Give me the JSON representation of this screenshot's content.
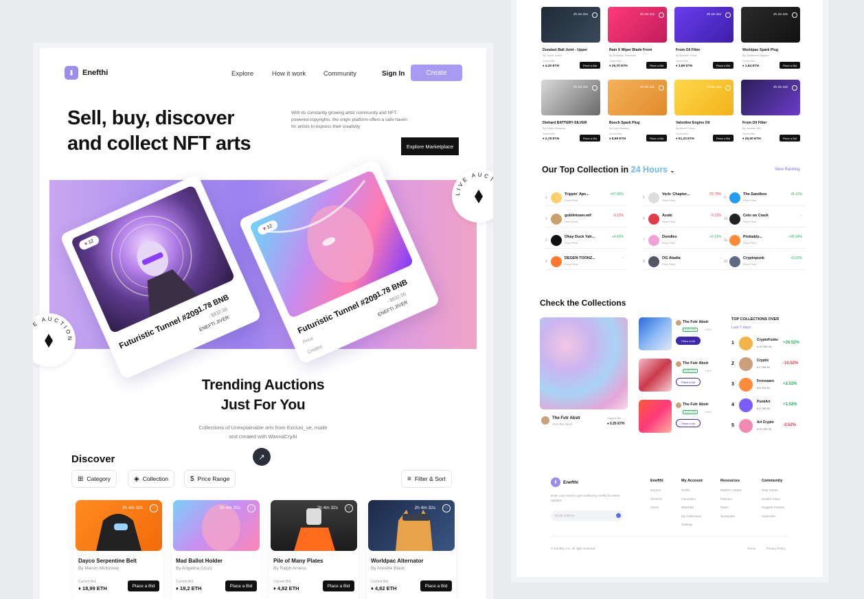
{
  "nav": {
    "brand": "Enefthi",
    "links": [
      "Explore",
      "How it work",
      "Community"
    ],
    "sign_in": "Sign In",
    "create": "Create"
  },
  "hero": {
    "title_line1": "Sell, buy, discover",
    "title_line2": "and collect NFT arts",
    "description": "With its constantly growing artist community and NFT-powered copyrights, the origin platform offers a safe haven for artists to express their creativity",
    "cta": "Explore Marketplace",
    "live_badge": "LIVE AUCTION"
  },
  "hero_cards": [
    {
      "title": "Futuristic Tunnel #209",
      "price": "1.78 BNB",
      "usd": "- $832.56",
      "creator": "ENEFTI JIVER",
      "likes": "12"
    },
    {
      "title": "Futuristic Tunnel #209",
      "price": "1.78 BNB",
      "usd": "- $832.56",
      "creator": "ENEFTI JIVER",
      "likes": "12",
      "price_label": "Price",
      "creator_label": "Creator"
    }
  ],
  "trending": {
    "title_line1": "Trending Auctions",
    "title_line2": "Just For You",
    "sub_line1": "Collections of Unexplainable arts from Exclusi_ve, made",
    "sub_line2": "and created with WannaCryAI"
  },
  "discover": {
    "title": "Discover",
    "filters": [
      "Category",
      "Collection",
      "Price Range"
    ],
    "filter_sort": "Filter & Sort",
    "items": [
      {
        "name": "Dayco Serpentine Belt",
        "by": "By Marvin McKinney",
        "timer": "2h 4m 32s",
        "bid_label": "Current Bid",
        "eth": "18,99 ETH",
        "button": "Place a Bid"
      },
      {
        "name": "Mad Ballot Holder",
        "by": "By Angelina Cruzz",
        "timer": "2h 4m 32s",
        "bid_label": "Current Bid",
        "eth": "18,2 ETH",
        "button": "Place a Bid"
      },
      {
        "name": "Pile of Many Plates",
        "by": "By Ralph Arness",
        "timer": "2h 4m 32s",
        "bid_label": "Current Bid",
        "eth": "4,82 ETH",
        "button": "Place a Bid"
      },
      {
        "name": "Worldpac Alternator",
        "by": "By Annette Black",
        "timer": "2h 4m 32s",
        "bid_label": "Current Bid",
        "eth": "4,82 ETH",
        "button": "Place a Bid"
      }
    ]
  },
  "right_grid": [
    {
      "name": "Duralast Ball Joint - Upper",
      "by": "By Jacob Jones",
      "eth": "4,30 ETH",
      "timer": "2h 4m 32s"
    },
    {
      "name": "Rain X Wiper Blade Front",
      "by": "By Brooklyn Simmons",
      "eth": "25,70 ETH",
      "timer": "2h 4m 32s"
    },
    {
      "name": "From Oil Filter",
      "by": "By Eleanor Pena",
      "eth": "3,89 ETH",
      "timer": "2h 4m 32s"
    },
    {
      "name": "Worldpac Spark Plug",
      "by": "By Savannah Nguyen",
      "eth": "1,94 ETH",
      "timer": "2h 4m 32s"
    },
    {
      "name": "Diehard BATTERY-SILVER",
      "by": "By Ralph Edwards",
      "eth": "2,78 ETH",
      "timer": "2h 4m 32s"
    },
    {
      "name": "Bosch Spark Plug",
      "by": "By Guy Hawkins",
      "eth": "8,99 ETH",
      "timer": "2h 4m 32s"
    },
    {
      "name": "Valvoline Engine Oil",
      "by": "By Albert Flores",
      "eth": "51,23 ETH",
      "timer": "2h 4m 32s"
    },
    {
      "name": "From Oil Filter",
      "by": "By Jerome Bell",
      "eth": "25,00 ETH",
      "timer": "2h 4m 32s"
    }
  ],
  "grid_bid_label": "Place a Bid",
  "grid_current_bid": "Current Bid",
  "top_collection": {
    "title": "Our Top Collection in",
    "highlight": "24 Hours",
    "view_ranking": "View Ranking",
    "floor_label": "Floor Price",
    "items": [
      {
        "rank": "1",
        "name": "Trippin' Ape...",
        "change": "+47.90%",
        "up": true
      },
      {
        "rank": "2",
        "name": "goblintown.wtf",
        "change": "-9.12%",
        "up": false
      },
      {
        "rank": "3",
        "name": "Okay Duck Yah...",
        "change": "+4.43%",
        "up": true
      },
      {
        "rank": "4",
        "name": "DEGEN TOONZ...",
        "change": "-",
        "up": true
      },
      {
        "rank": "5",
        "name": "Verb: Chapter...",
        "change": "-75.79%",
        "up": false
      },
      {
        "rank": "6",
        "name": "Azuki",
        "change": "-9.12%",
        "up": false
      },
      {
        "rank": "7",
        "name": "Doodles",
        "change": "+0.13%",
        "up": true
      },
      {
        "rank": "8",
        "name": "OG Atadia",
        "change": "-",
        "up": true
      },
      {
        "rank": "9",
        "name": "The Sandbox",
        "change": "+8.12%",
        "up": true
      },
      {
        "rank": "10",
        "name": "Cets on Crack",
        "change": "-",
        "up": true
      },
      {
        "rank": "11",
        "name": "Probably...",
        "change": "+95.04%",
        "up": true
      },
      {
        "rank": "12",
        "name": "Cryptopunk",
        "change": "+0.32%",
        "up": true
      }
    ]
  },
  "check": {
    "title": "Check the Collections",
    "main_name": "The Futr Abstr",
    "main_sub": "10 in the stock",
    "highest_label": "Highest Bid",
    "highest": "0.25 ETH",
    "side_items": [
      {
        "name": "The Futr Abstr",
        "eth": "0.25 ETH",
        "of": "1 of 8",
        "button": "Place a bid",
        "filled": true
      },
      {
        "name": "The Futr Abstr",
        "eth": "0.25 ETH",
        "of": "1 of 8",
        "button": "Place a bid",
        "filled": false
      },
      {
        "name": "The Futr Abstr",
        "eth": "0.25 ETH",
        "of": "1 of 8",
        "button": "Place a bid",
        "filled": false
      }
    ],
    "top_title": "TOP COLLECTIONS OVER",
    "top_period": "Last 7 days",
    "top_items": [
      {
        "rank": "1",
        "name": "CryptoFunks",
        "eth": "19,769.39",
        "change": "+26.52%",
        "up": true
      },
      {
        "rank": "2",
        "name": "Cryptix",
        "eth": "2,769.39",
        "change": "-10.52%",
        "up": false
      },
      {
        "rank": "3",
        "name": "Frensware",
        "eth": "9,232.39",
        "change": "+2.52%",
        "up": true
      },
      {
        "rank": "4",
        "name": "PunkArt",
        "eth": "3,769.39",
        "change": "+1.52%",
        "up": true
      },
      {
        "rank": "5",
        "name": "Art Crypto",
        "eth": "10,769.39",
        "change": "-2.52%",
        "up": false
      }
    ]
  },
  "footer": {
    "brand": "Enefthi",
    "tagline": "Enter your email to get notified by enefthi for latest updates",
    "email_placeholder": "Email Address",
    "columns": [
      {
        "title": "Enefthi",
        "links": [
          "Explore",
          "All NFTs",
          "About"
        ]
      },
      {
        "title": "My Account",
        "links": [
          "Profile",
          "Favourites",
          "Watchlist",
          "My Collections",
          "Settings"
        ]
      },
      {
        "title": "Resources",
        "links": [
          "Platform Status",
          "Partners",
          "Taxes",
          "Newsletter"
        ]
      },
      {
        "title": "Community",
        "links": [
          "Help Center",
          "Enefthi Token",
          "Suggest Feature",
          "Subscribe"
        ]
      }
    ],
    "copyright": "© Enefthy, Inc. All right reserved.",
    "terms": "Terms",
    "privacy": "Privacy Policy"
  },
  "colors": {
    "accent": "#a89af2",
    "up": "#22b45a",
    "down": "#e0364f",
    "dark": "#111111"
  }
}
